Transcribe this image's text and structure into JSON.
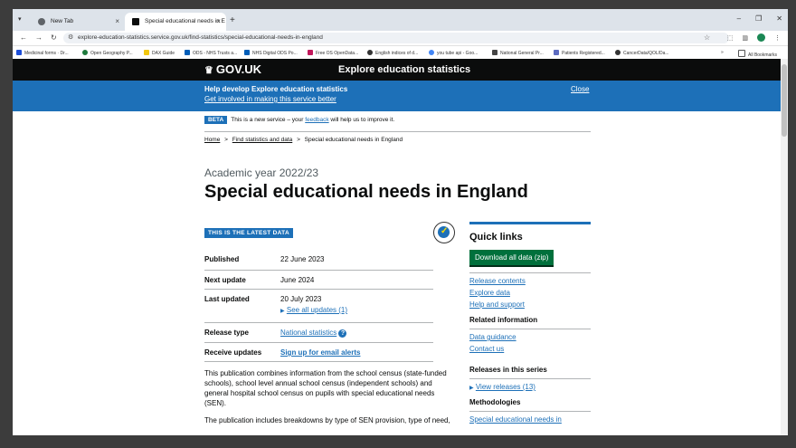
{
  "browser": {
    "tabs": [
      {
        "label": "New Tab"
      },
      {
        "label": "Special educational needs in E"
      }
    ],
    "url": "explore-education-statistics.service.gov.uk/find-statistics/special-educational-needs-in-england",
    "bookmarks": [
      "Medicinal forms · Dr...",
      "Open Geography P...",
      "DAX Guide",
      "ODS - NHS Trusts a...",
      "NHS Digital ODS Po...",
      "Free OS OpenData...",
      "English indices of d...",
      "you tube api - Goo...",
      "National General Pr...",
      "Patients Registered...",
      "CancerData/QOL/Da..."
    ],
    "all_bookmarks": "All Bookmarks"
  },
  "header": {
    "logo": "GOV.UK",
    "service": "Explore education statistics"
  },
  "banner": {
    "title": "Help develop Explore education statistics",
    "link": "Get involved in making this service better",
    "close": "Close"
  },
  "beta": {
    "tag": "BETA",
    "text_before": "This is a new service – your ",
    "link": "feedback",
    "text_after": " will help us to improve it."
  },
  "breadcrumbs": {
    "home": "Home",
    "find": "Find statistics and data",
    "current": "Special educational needs in England",
    "sep": ">"
  },
  "caption": "Academic year 2022/23",
  "title": "Special educational needs in England",
  "latest_tag": "THIS IS THE LATEST DATA",
  "meta": {
    "published_k": "Published",
    "published_v": "22 June 2023",
    "next_k": "Next update",
    "next_v": "June 2024",
    "updated_k": "Last updated",
    "updated_v": "20 July 2023",
    "updates_link": "See all updates (1)",
    "type_k": "Release type",
    "type_v": "National statistics",
    "receive_k": "Receive updates",
    "receive_v": "Sign up for email alerts"
  },
  "intro": {
    "p1": "This publication combines information from the school census (state-funded schools), school level annual school census (independent schools) and general hospital school census on pupils with special educational needs (SEN).",
    "p2": "The publication includes breakdowns by type of SEN provision, type of need,"
  },
  "quick_links": {
    "title": "Quick links",
    "download": "Download all data (zip)",
    "links": [
      "Release contents",
      "Explore data",
      "Help and support"
    ],
    "related_title": "Related information",
    "related": [
      "Data guidance",
      "Contact us"
    ],
    "series_title": "Releases in this series",
    "series_link": "View releases (13)",
    "methodologies_title": "Methodologies",
    "methodologies_link": "Special educational needs in"
  }
}
